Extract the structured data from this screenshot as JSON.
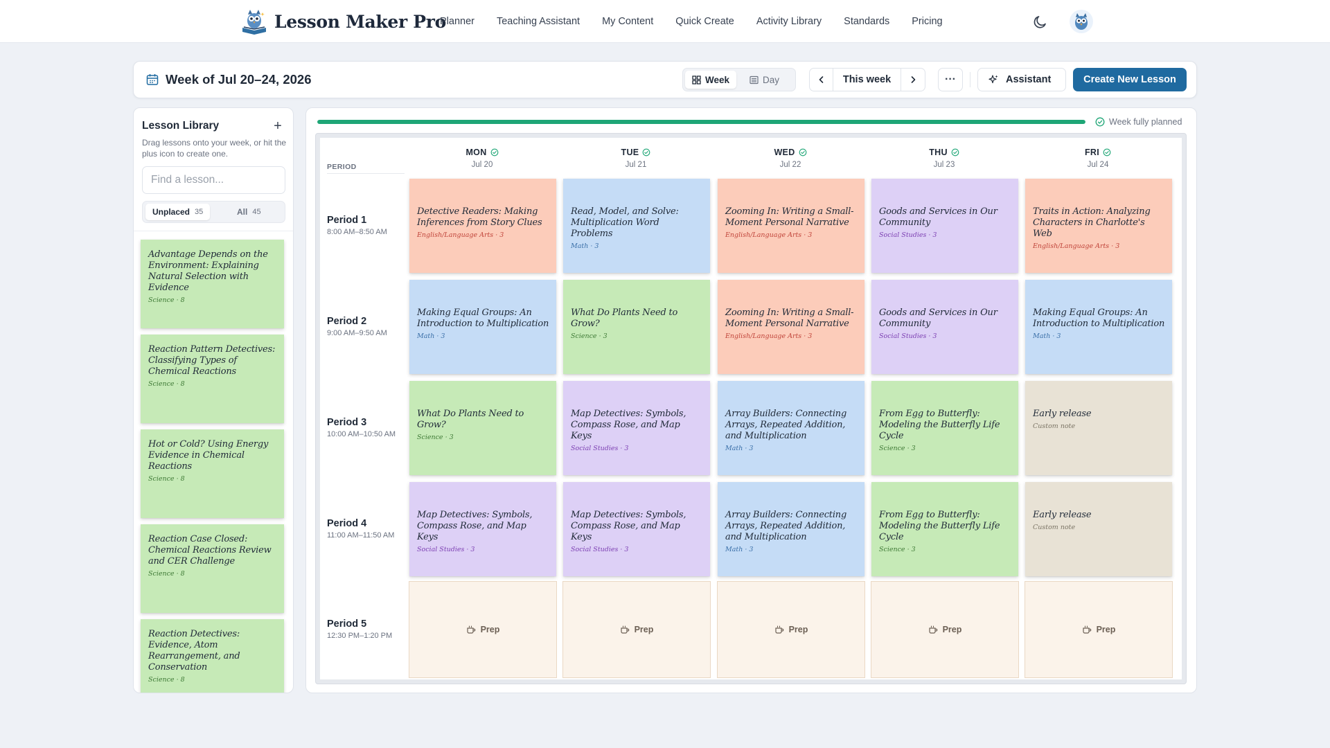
{
  "brand": {
    "name": "Lesson Maker Pro"
  },
  "nav": [
    "Planner",
    "Teaching Assistant",
    "My Content",
    "Quick Create",
    "Activity Library",
    "Standards",
    "Pricing"
  ],
  "icons": {
    "theme_toggle": "moon-icon",
    "avatar": "owl-avatar",
    "calendar": "calendar-icon",
    "week_view": "grid-icon",
    "day_view": "list-icon",
    "prev": "chevron-left-icon",
    "next": "chevron-right-icon",
    "more": "ellipsis-icon",
    "assistant": "sparkle-icon",
    "add": "plus-icon",
    "planned": "check-circle-icon",
    "prep": "coffee-cup-icon"
  },
  "colors": {
    "accent": "#1f6aa0",
    "progress": "#1ea676",
    "science": "#c6eab7",
    "ela": "#fcccba",
    "math": "#c5dcf6",
    "social_studies": "#ddd0f6",
    "custom": "#e8e2d5",
    "prep": "#fbf3ea"
  },
  "header": {
    "week_title": "Week of Jul 20–24, 2026",
    "view_week": "Week",
    "view_day": "Day",
    "this_week": "This week",
    "more": "···",
    "assistant": "Assistant",
    "create": "Create New Lesson"
  },
  "library": {
    "title": "Lesson Library",
    "add": "+",
    "description": "Drag lessons onto your week, or hit the plus icon to create one.",
    "search_placeholder": "Find a lesson...",
    "tab_unplaced": "Unplaced",
    "tab_unplaced_count": "35",
    "tab_all": "All",
    "tab_all_count": "45",
    "items": [
      {
        "title": "Advantage Depends on the Environment: Explaining Natural Selection with Evidence",
        "meta": "Science · 8",
        "color": "green"
      },
      {
        "title": "Reaction Pattern Detectives: Classifying Types of Chemical Reactions",
        "meta": "Science · 8",
        "color": "green"
      },
      {
        "title": "Hot or Cold? Using Energy Evidence in Chemical Reactions",
        "meta": "Science · 8",
        "color": "green"
      },
      {
        "title": "Reaction Case Closed: Chemical Reactions Review and CER Challenge",
        "meta": "Science · 8",
        "color": "green"
      },
      {
        "title": "Reaction Detectives: Evidence, Atom Rearrangement, and Conservation",
        "meta": "Science · 8",
        "color": "green"
      }
    ]
  },
  "planner": {
    "progress_fraction": 1.0,
    "status": "Week fully planned",
    "period_header": "PERIOD",
    "days": [
      {
        "name": "MON",
        "date": "Jul 20"
      },
      {
        "name": "TUE",
        "date": "Jul 21"
      },
      {
        "name": "WED",
        "date": "Jul 22"
      },
      {
        "name": "THU",
        "date": "Jul 23"
      },
      {
        "name": "FRI",
        "date": "Jul 24"
      }
    ],
    "periods": [
      {
        "name": "Period 1",
        "time": "8:00 AM–8:50 AM"
      },
      {
        "name": "Period 2",
        "time": "9:00 AM–9:50 AM"
      },
      {
        "name": "Period 3",
        "time": "10:00 AM–10:50 AM"
      },
      {
        "name": "Period 4",
        "time": "11:00 AM–11:50 AM"
      },
      {
        "name": "Period 5",
        "time": "12:30 PM–1:20 PM"
      }
    ],
    "prep_label": "Prep",
    "cells": [
      [
        {
          "title": "Detective Readers: Making Inferences from Story Clues",
          "meta": "English/Language Arts · 3",
          "color": "peach"
        },
        {
          "title": "Read, Model, and Solve: Multiplication Word Problems",
          "meta": "Math · 3",
          "color": "blue"
        },
        {
          "title": "Zooming In: Writing a Small-Moment Personal Narrative",
          "meta": "English/Language Arts · 3",
          "color": "peach"
        },
        {
          "title": "Goods and Services in Our Community",
          "meta": "Social Studies · 3",
          "color": "purple"
        },
        {
          "title": "Traits in Action: Analyzing Characters in Charlotte's Web",
          "meta": "English/Language Arts · 3",
          "color": "peach"
        }
      ],
      [
        {
          "title": "Making Equal Groups: An Introduction to Multiplication",
          "meta": "Math · 3",
          "color": "blue"
        },
        {
          "title": "What Do Plants Need to Grow?",
          "meta": "Science · 3",
          "color": "green"
        },
        {
          "title": "Zooming In: Writing a Small-Moment Personal Narrative",
          "meta": "English/Language Arts · 3",
          "color": "peach"
        },
        {
          "title": "Goods and Services in Our Community",
          "meta": "Social Studies · 3",
          "color": "purple"
        },
        {
          "title": "Making Equal Groups: An Introduction to Multiplication",
          "meta": "Math · 3",
          "color": "blue"
        }
      ],
      [
        {
          "title": "What Do Plants Need to Grow?",
          "meta": "Science · 3",
          "color": "green"
        },
        {
          "title": "Map Detectives: Symbols, Compass Rose, and Map Keys",
          "meta": "Social Studies · 3",
          "color": "purple"
        },
        {
          "title": "Array Builders: Connecting Arrays, Repeated Addition, and Multiplication",
          "meta": "Math · 3",
          "color": "blue"
        },
        {
          "title": "From Egg to Butterfly: Modeling the Butterfly Life Cycle",
          "meta": "Science · 3",
          "color": "green"
        },
        {
          "title": "Early release",
          "meta": "Custom note",
          "color": "tan"
        }
      ],
      [
        {
          "title": "Map Detectives: Symbols, Compass Rose, and Map Keys",
          "meta": "Social Studies · 3",
          "color": "purple"
        },
        {
          "title": "Map Detectives: Symbols, Compass Rose, and Map Keys",
          "meta": "Social Studies · 3",
          "color": "purple"
        },
        {
          "title": "Array Builders: Connecting Arrays, Repeated Addition, and Multiplication",
          "meta": "Math · 3",
          "color": "blue"
        },
        {
          "title": "From Egg to Butterfly: Modeling the Butterfly Life Cycle",
          "meta": "Science · 3",
          "color": "green"
        },
        {
          "title": "Early release",
          "meta": "Custom note",
          "color": "tan"
        }
      ]
    ]
  }
}
